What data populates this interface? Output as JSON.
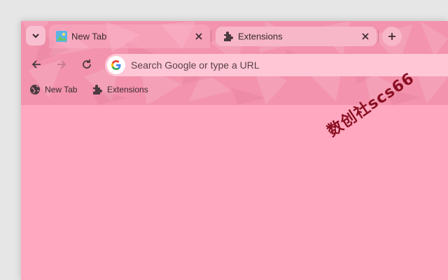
{
  "tabs": [
    {
      "title": "New Tab",
      "favicon": "image-icon",
      "active": true
    },
    {
      "title": "Extensions",
      "favicon": "puzzle-icon",
      "active": false
    }
  ],
  "toolbar": {
    "omnibox_placeholder": "Search Google or type a URL"
  },
  "bookmarks": [
    {
      "label": "New Tab",
      "icon": "globe-icon"
    },
    {
      "label": "Extensions",
      "icon": "puzzle-icon"
    }
  ],
  "watermark": "数创社scs66",
  "colors": {
    "frame": "#f393ad",
    "content": "#ffa8bf",
    "omnibox": "#ffc6d6",
    "watermark": "#8a0f22"
  }
}
